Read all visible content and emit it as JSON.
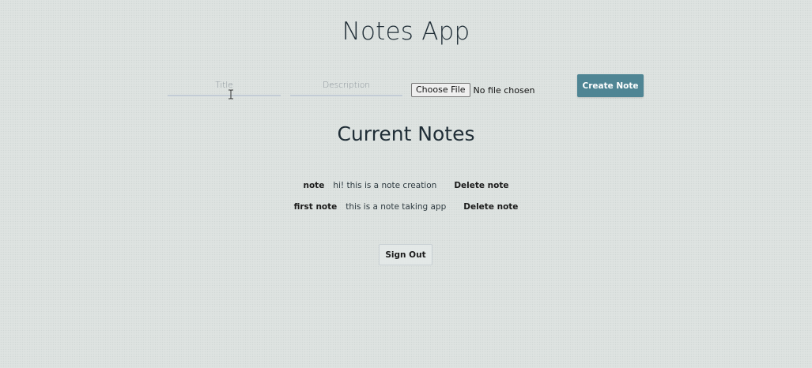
{
  "app": {
    "title": "Notes App"
  },
  "form": {
    "title_placeholder": "Title",
    "title_value": "",
    "description_placeholder": "Description",
    "description_value": "",
    "file_button_label": "Choose File",
    "file_status": "No file chosen",
    "create_button_label": "Create Note"
  },
  "notes_section": {
    "heading": "Current Notes",
    "notes": [
      {
        "name": "note",
        "description": "hi! this is a note creation",
        "delete_label": "Delete note"
      },
      {
        "name": "first note",
        "description": "this is a note taking app",
        "delete_label": "Delete note"
      }
    ]
  },
  "auth": {
    "sign_out_label": "Sign Out"
  },
  "colors": {
    "background": "#dee3e1",
    "accent": "#4f8594",
    "text": "#1f2d36"
  },
  "icons": {
    "cursor": "text-cursor-icon"
  }
}
